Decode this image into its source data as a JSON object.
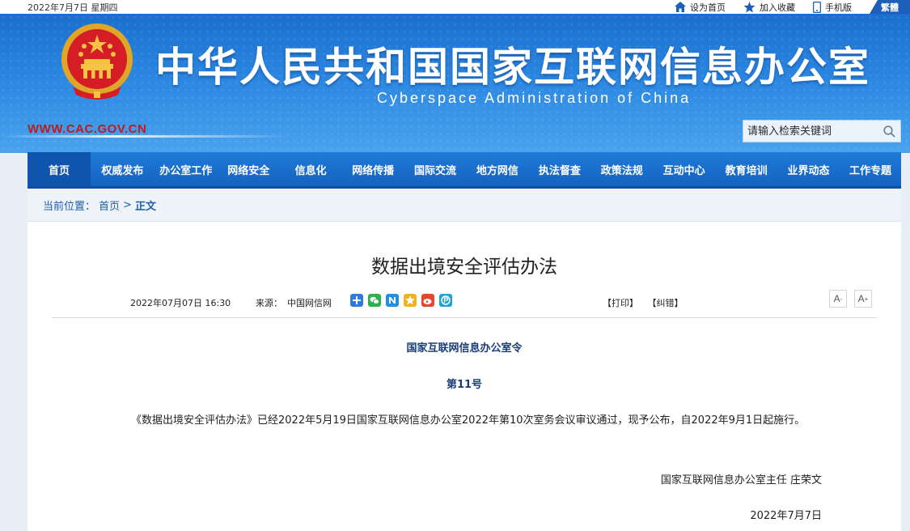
{
  "topbar": {
    "date": "2022年7月7日 星期四",
    "links": [
      "设为首页",
      "加入收藏",
      "手机版"
    ],
    "traditional": "繁體"
  },
  "header": {
    "title_cn": "中华人民共和国国家互联网信息办公室",
    "title_en": "Cyberspace Administration of China",
    "url": "WWW.CAC.GOV.CN",
    "search_placeholder": "请输入检索关键词"
  },
  "nav": {
    "items": [
      "首页",
      "权威发布",
      "办公室工作",
      "网络安全",
      "信息化",
      "网络传播",
      "国际交流",
      "地方网信",
      "执法督查",
      "政策法规",
      "互动中心",
      "教育培训",
      "业界动态",
      "工作专题"
    ],
    "active_index": 0
  },
  "breadcrumb": {
    "prefix": "当前位置：",
    "home": "首页",
    "sep": ">",
    "current": "正文"
  },
  "article": {
    "title": "数据出境安全评估办法",
    "datetime": "2022年07月07日 16:30",
    "source_label": "来源：",
    "source": "中国网信网",
    "print": "【打印】",
    "correct": "【纠错】",
    "font_smaller": "A",
    "font_larger": "A",
    "order_title": "国家互联网信息办公室令",
    "order_no": "第11号",
    "paragraph": "《数据出境安全评估办法》已经2022年5月19日国家互联网信息办公室2022年第10次室务会议审议通过，现予公布，自2022年9月1日起施行。",
    "signature": "国家互联网信息办公室主任 庄荣文",
    "sign_date": "2022年7月7日"
  },
  "colors": {
    "nav_blue": "#1563c0",
    "url_red": "#c8161d",
    "order_blue": "#1a3d7a"
  }
}
